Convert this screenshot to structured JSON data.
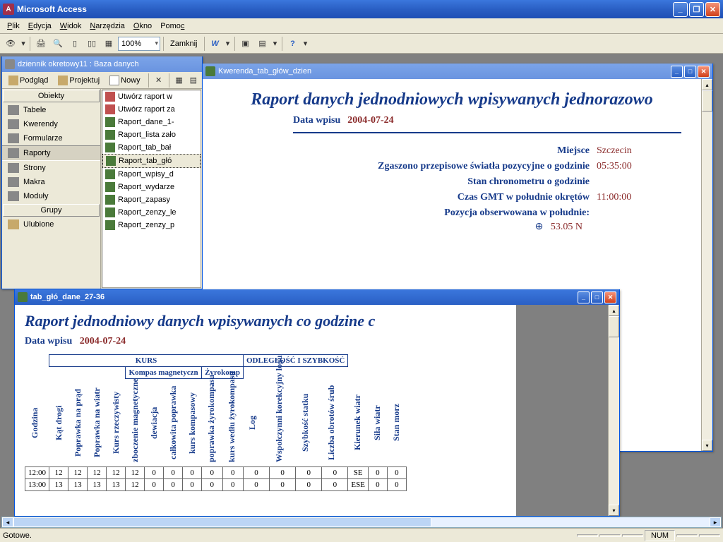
{
  "app": {
    "title": "Microsoft Access"
  },
  "menu": {
    "items": [
      "Plik",
      "Edycja",
      "Widok",
      "Narzędzia",
      "Okno",
      "Pomoc"
    ]
  },
  "toolbar": {
    "zoom": "100%",
    "close_label": "Zamknij"
  },
  "db_window": {
    "title": "dziennik okretowy11 : Baza danych",
    "toolbar": {
      "preview": "Podgląd",
      "design": "Projektuj",
      "new": "Nowy"
    },
    "side": {
      "objects_hdr": "Obiekty",
      "groups_hdr": "Grupy",
      "items": [
        "Tabele",
        "Kwerendy",
        "Formularze",
        "Raporty",
        "Strony",
        "Makra",
        "Moduły"
      ],
      "favorites": "Ulubione",
      "selected": "Raporty"
    },
    "list": [
      {
        "label": "Utwórz raport w",
        "wizard": true
      },
      {
        "label": "Utwórz raport za",
        "wizard": true
      },
      {
        "label": "Raport_dane_1-"
      },
      {
        "label": "Raport_lista zało"
      },
      {
        "label": "Raport_tab_bał"
      },
      {
        "label": "Raport_tab_głó",
        "selected": true
      },
      {
        "label": "Raport_wpisy_d"
      },
      {
        "label": "Raport_wydarze"
      },
      {
        "label": "Raport_zapasy"
      },
      {
        "label": "Raport_zenzy_le"
      },
      {
        "label": "Raport_zenzy_p"
      }
    ]
  },
  "report1": {
    "title": "Kwerenda_tab_głów_dzien",
    "heading": "Raport danych jednodniowych wpisywanych jednorazowo",
    "date_label": "Data wpisu",
    "date_value": "2004-07-24",
    "rows": [
      {
        "label": "Miejsce",
        "value": "Szczecin"
      },
      {
        "label": "Zgaszono przepisowe światła pozycyjne o godzinie",
        "value": "05:35:00"
      },
      {
        "label": "Stan chronometru o godzinie",
        "value": ""
      },
      {
        "label": "Czas GMT w południe okrętów",
        "value": "11:00:00"
      },
      {
        "label": "Pozycja obserwowana w południe:",
        "value": ""
      }
    ],
    "lat_value": "53.05 N"
  },
  "report2": {
    "title": "tab_głó_dane_27-36",
    "heading": "Raport jednodniowy danych wpisywanych co godzine c",
    "date_label": "Data wpisu",
    "date_value": "2004-07-24",
    "group_headers": {
      "kurs": "KURS",
      "kompas_mag": "Kompas magnetyczn",
      "zyrokomp": "Żyrokomp",
      "odleglosc": "ODLEGŁOŚĆ I SZYBKOŚĆ"
    },
    "columns": [
      "Godzina",
      "Kąt drogi",
      "Poprawka na prąd",
      "Poprawka na wiatr",
      "Kurs rzeczywisty",
      "zboczenie magnetyczne",
      "dewiacja",
      "całkowita poprawka",
      "kurs kompasowy",
      "poprawka żyrokompasu",
      "kurs wedłu żyrokompasu",
      "Log",
      "Wspołczynni korekcyjny logu",
      "Szybkość statku",
      "Liczba obrotów śrub",
      "Kierunek wiatr",
      "Siła wiatr",
      "Stan morz"
    ],
    "rows": [
      [
        "12:00",
        "12",
        "12",
        "12",
        "12",
        "12",
        "0",
        "0",
        "0",
        "0",
        "0",
        "0",
        "0",
        "0",
        "0",
        "SE",
        "0",
        "0"
      ],
      [
        "13:00",
        "13",
        "13",
        "13",
        "13",
        "12",
        "0",
        "0",
        "0",
        "0",
        "0",
        "0",
        "0",
        "0",
        "0",
        "ESE",
        "0",
        "0"
      ]
    ]
  },
  "status": {
    "ready": "Gotowe.",
    "num": "NUM"
  }
}
